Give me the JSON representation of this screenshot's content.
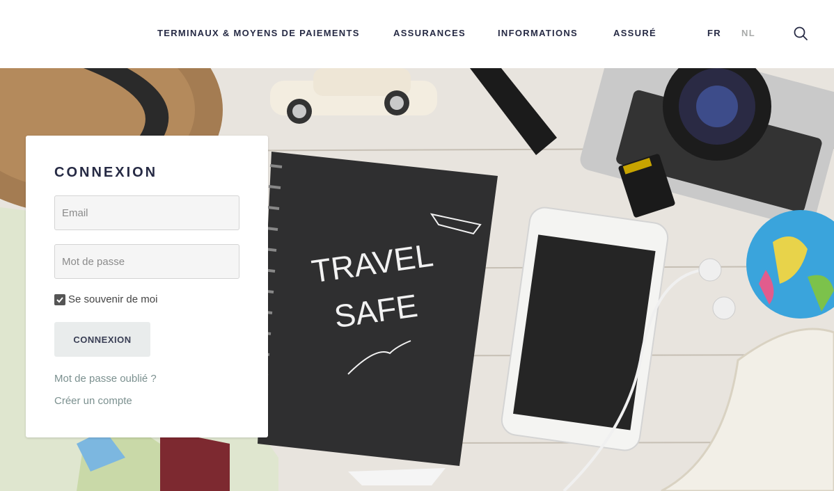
{
  "nav": {
    "items": [
      {
        "label": "TERMINAUX & MOYENS DE PAIEMENTS"
      },
      {
        "label": "ASSURANCES"
      },
      {
        "label": "INFORMATIONS"
      },
      {
        "label": "ASSURÉ"
      }
    ],
    "languages": [
      {
        "label": "FR",
        "active": true
      },
      {
        "label": "NL",
        "active": false
      }
    ],
    "search_icon": "search-icon"
  },
  "hero": {
    "notebook_text_line1": "TRAVEL",
    "notebook_text_line2": "SAFE"
  },
  "login": {
    "title": "CONNEXION",
    "email_placeholder": "Email",
    "email_value": "",
    "password_placeholder": "Mot de passe",
    "password_value": "",
    "remember_label": "Se souvenir de moi",
    "remember_checked": true,
    "submit_label": "CONNEXION",
    "forgot_password_label": "Mot de passe oublié ?",
    "create_account_label": "Créer un compte"
  },
  "colors": {
    "nav_text": "#262a44",
    "lang_inactive": "#a8aaa9",
    "link": "#7b908f",
    "button_bg": "#e9ecec"
  }
}
